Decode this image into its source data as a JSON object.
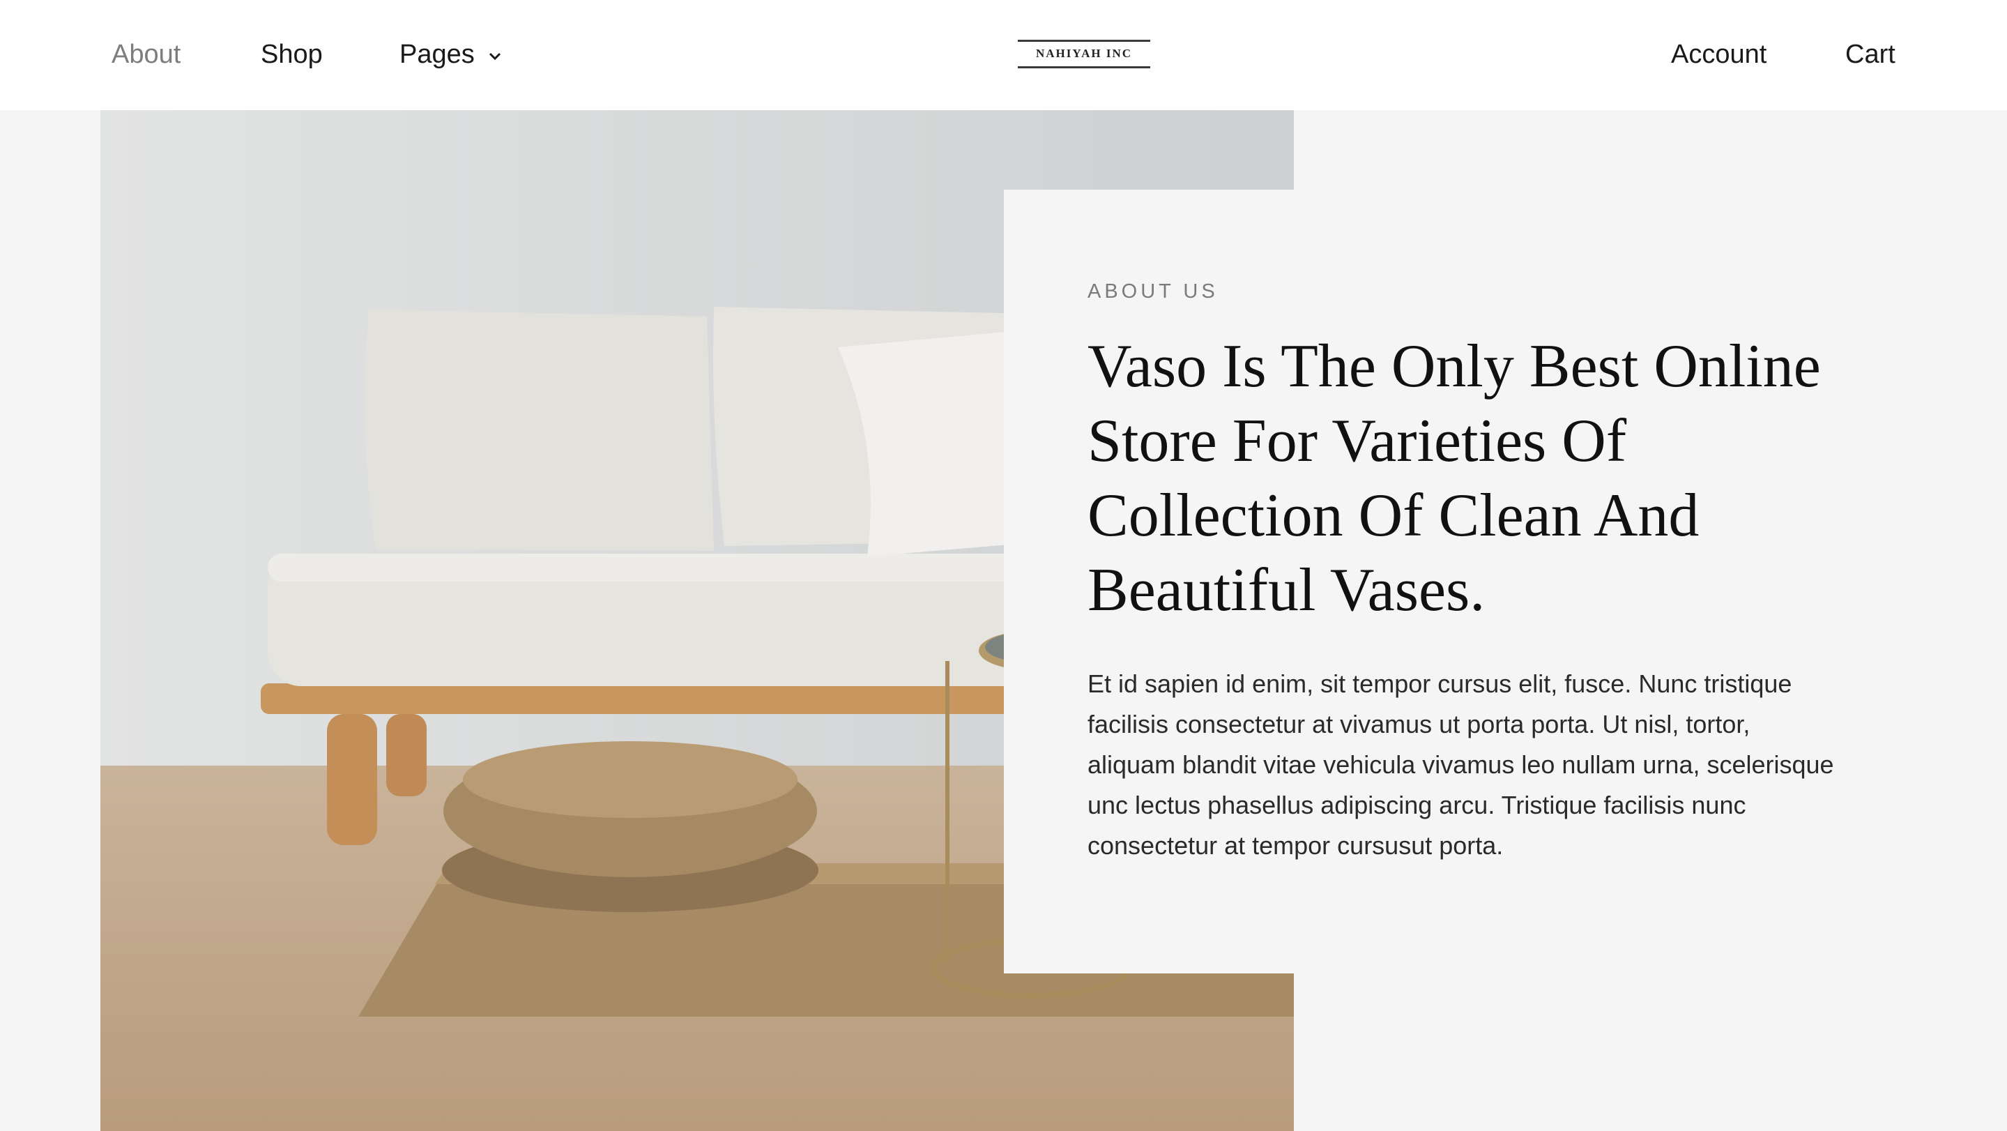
{
  "nav": {
    "left": [
      {
        "label": "About",
        "active": true
      },
      {
        "label": "Shop",
        "active": false
      },
      {
        "label": "Pages",
        "active": false,
        "icon": "chevron-down-icon"
      }
    ],
    "logo_text": "NAHIYAH INC",
    "right": [
      {
        "label": "Account"
      },
      {
        "label": "Cart"
      }
    ]
  },
  "hero": {
    "image": "sofa-living-room-photo"
  },
  "about": {
    "eyebrow": "ABOUT US",
    "headline": "Vaso Is The Only Best Online Store For Varieties Of Collection Of Clean And Beautiful Vases.",
    "body": "Et id sapien id enim, sit tempor cursus elit, fusce. Nunc tristique facilisis consectetur at vivamus ut porta porta. Ut nisl, tortor, aliquam blandit vitae vehicula vivamus leo nullam urna, scelerisque unc lectus phasellus adipiscing arcu. Tristique facilisis nunc consectetur at tempor cursusut porta."
  },
  "colors": {
    "page_bg": "#f5f5f5",
    "nav_bg": "#ffffff",
    "text": "#111111",
    "muted": "#7d7d7d"
  }
}
